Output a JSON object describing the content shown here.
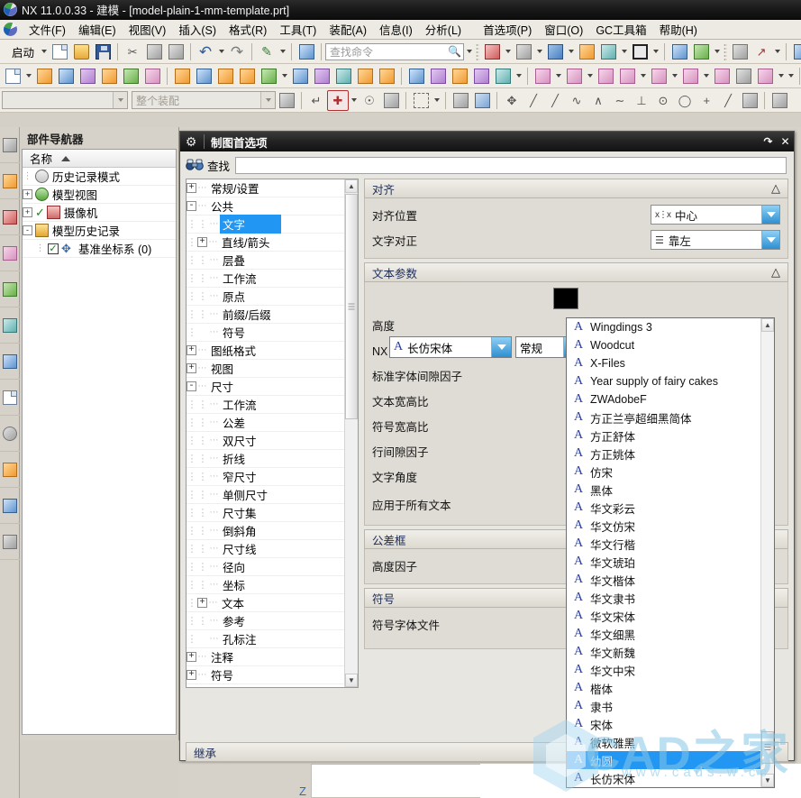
{
  "window": {
    "title": "NX 11.0.0.33 - 建模 - [model-plain-1-mm-template.prt]",
    "logo_icon": "nx-logo-icon"
  },
  "menubar": {
    "logo_icon": "nx-menu-logo-icon",
    "items": [
      {
        "label": "文件(F)",
        "name": "menu-file"
      },
      {
        "label": "编辑(E)",
        "name": "menu-edit"
      },
      {
        "label": "视图(V)",
        "name": "menu-view"
      },
      {
        "label": "插入(S)",
        "name": "menu-insert"
      },
      {
        "label": "格式(R)",
        "name": "menu-format"
      },
      {
        "label": "工具(T)",
        "name": "menu-tools"
      },
      {
        "label": "装配(A)",
        "name": "menu-assemblies"
      },
      {
        "label": "信息(I)",
        "name": "menu-information"
      },
      {
        "label": "分析(L)",
        "name": "menu-analysis"
      },
      {
        "label": "首选项(P)",
        "name": "menu-preferences"
      },
      {
        "label": "窗口(O)",
        "name": "menu-window"
      },
      {
        "label": "GC工具箱",
        "name": "menu-gc-toolbox"
      },
      {
        "label": "帮助(H)",
        "name": "menu-help"
      }
    ]
  },
  "toolbar_standard": {
    "start_label": "启动",
    "find_command_placeholder": "查找命令",
    "icons": [
      "new-document-icon",
      "open-folder-icon",
      "save-icon",
      "cut-icon",
      "copy-icon",
      "paste-icon",
      "undo-icon",
      "redo-icon",
      "paint-icon",
      "snapshot-icon"
    ]
  },
  "toolbar_view": {
    "icons": [
      "fit-window-icon",
      "zoom-icon",
      "rotate-cube-icon",
      "pan-icon",
      "style-icon",
      "shade-icon",
      "section-icon",
      "clip-icon",
      "layer-icon",
      "wcs-icon",
      "measure-icon",
      "color-icon"
    ]
  },
  "toolbar_feature": {
    "icons": [
      "sketch-icon",
      "datum-plane-icon",
      "extrude-icon",
      "revolve-icon",
      "hole-icon",
      "boss-icon",
      "pocket-icon",
      "pad-icon",
      "slot-icon",
      "groove-icon",
      "blend-icon",
      "chamfer-icon",
      "draft-icon",
      "trim-icon",
      "offset-icon",
      "pattern-icon",
      "mirror-icon",
      "thread-icon",
      "shell-icon",
      "unite-icon",
      "subtract-icon",
      "intersect-icon",
      "move-face-icon",
      "tube-icon"
    ]
  },
  "toolbar_selection": {
    "filter_value": "",
    "scope_value": "整个装配",
    "icons": [
      "select-object-icon",
      "snap-point-filter-icon",
      "add-snap-point-icon",
      "wcs-origin-icon",
      "curve-rule-icon",
      "rectangle-select-icon",
      "solid-body-icon",
      "shaded-cube-icon",
      "move-object-icon",
      "line-icon",
      "line2-icon",
      "spline-icon",
      "arc-through-icon",
      "studio-spline-icon",
      "perpendicular-icon",
      "circle-center-icon",
      "circle-icon",
      "plus-icon",
      "diagonal-icon",
      "sheet-icon",
      "grid-icon"
    ]
  },
  "part_navigator": {
    "title": "部件导航器",
    "column_header": "名称",
    "sort_icon": "sort-ascending-icon",
    "rows": [
      {
        "label": "历史记录模式",
        "icon": "clock-icon",
        "expander": null,
        "checkbox": false,
        "depth": 1
      },
      {
        "label": "模型视图",
        "icon": "model-views-icon",
        "expander": "+",
        "checkbox": false,
        "depth": 0
      },
      {
        "label": "摄像机",
        "icon": "camera-icon",
        "expander": "+",
        "checkbox": false,
        "depth": 0,
        "check_mark": true
      },
      {
        "label": "模型历史记录",
        "icon": "folder-open-icon",
        "expander": "-",
        "checkbox": false,
        "depth": 0
      },
      {
        "label": "基准坐标系 (0)",
        "icon": "datum-csys-icon",
        "expander": null,
        "checkbox": true,
        "depth": 1
      }
    ]
  },
  "rail": {
    "icons": [
      "assembly-navigator-icon",
      "constraint-navigator-icon",
      "part-navigator-icon",
      "reuse-library-icon",
      "cloud-library-icon",
      "help-web-icon",
      "hd3d-tools-icon",
      "history-icon",
      "roles-icon",
      "system-scene-icon",
      "system-visualization-icon"
    ]
  },
  "dialog": {
    "title": "制图首选项",
    "gear_icon": "gear-icon",
    "window_buttons": [
      "restore-icon",
      "close-icon"
    ],
    "find": {
      "icon": "binoculars-icon",
      "label": "查找",
      "value": "",
      "placeholder": ""
    },
    "tree": [
      {
        "label": "常规/设置",
        "expander": "+",
        "depth": 0,
        "selected": false
      },
      {
        "label": "公共",
        "expander": "-",
        "depth": 0,
        "selected": false
      },
      {
        "label": "文字",
        "expander": null,
        "depth": 2,
        "selected": true
      },
      {
        "label": "直线/箭头",
        "expander": "+",
        "depth": 1,
        "selected": false
      },
      {
        "label": "层叠",
        "expander": null,
        "depth": 2,
        "selected": false
      },
      {
        "label": "工作流",
        "expander": null,
        "depth": 2,
        "selected": false
      },
      {
        "label": "原点",
        "expander": null,
        "depth": 2,
        "selected": false
      },
      {
        "label": "前缀/后缀",
        "expander": null,
        "depth": 2,
        "selected": false
      },
      {
        "label": "符号",
        "expander": null,
        "depth": 2,
        "selected": false
      },
      {
        "label": "图纸格式",
        "expander": "+",
        "depth": 0,
        "selected": false
      },
      {
        "label": "视图",
        "expander": "+",
        "depth": 0,
        "selected": false
      },
      {
        "label": "尺寸",
        "expander": "-",
        "depth": 0,
        "selected": false
      },
      {
        "label": "工作流",
        "expander": null,
        "depth": 2,
        "selected": false
      },
      {
        "label": "公差",
        "expander": null,
        "depth": 2,
        "selected": false
      },
      {
        "label": "双尺寸",
        "expander": null,
        "depth": 2,
        "selected": false
      },
      {
        "label": "折线",
        "expander": null,
        "depth": 2,
        "selected": false
      },
      {
        "label": "窄尺寸",
        "expander": null,
        "depth": 2,
        "selected": false
      },
      {
        "label": "单侧尺寸",
        "expander": null,
        "depth": 2,
        "selected": false
      },
      {
        "label": "尺寸集",
        "expander": null,
        "depth": 2,
        "selected": false
      },
      {
        "label": "倒斜角",
        "expander": null,
        "depth": 2,
        "selected": false
      },
      {
        "label": "尺寸线",
        "expander": null,
        "depth": 2,
        "selected": false
      },
      {
        "label": "径向",
        "expander": null,
        "depth": 2,
        "selected": false
      },
      {
        "label": "坐标",
        "expander": null,
        "depth": 2,
        "selected": false
      },
      {
        "label": "文本",
        "expander": "+",
        "depth": 1,
        "selected": false
      },
      {
        "label": "参考",
        "expander": null,
        "depth": 2,
        "selected": false
      },
      {
        "label": "孔标注",
        "expander": null,
        "depth": 2,
        "selected": false
      },
      {
        "label": "注释",
        "expander": "+",
        "depth": 0,
        "selected": false
      },
      {
        "label": "符号",
        "expander": "+",
        "depth": 0,
        "selected": false
      }
    ],
    "sections": {
      "alignment": {
        "header": "对齐",
        "collapse_icon": "chevron-up-icon",
        "rows": [
          {
            "label": "对齐位置",
            "value": "中心",
            "value_icon": "align-center-icon"
          },
          {
            "label": "文字对正",
            "value": "靠左",
            "value_icon": "text-align-left-icon"
          }
        ]
      },
      "text_parameters": {
        "header": "文本参数",
        "collapse_icon": "chevron-up-icon",
        "color_swatch": "#000000",
        "font_name": "长仿宋体",
        "font_style": "常规",
        "rows": [
          {
            "label": "高度"
          },
          {
            "label": "NX 字体间隙因子"
          },
          {
            "label": "标准字体间隙因子"
          },
          {
            "label": "文本宽高比"
          },
          {
            "label": "符号宽高比"
          },
          {
            "label": "行间隙因子"
          },
          {
            "label": "文字角度"
          },
          {
            "label": "应用于所有文本"
          }
        ]
      },
      "tolerance_frame": {
        "header": "公差框",
        "rows": [
          {
            "label": "高度因子"
          }
        ]
      },
      "symbol": {
        "header": "符号",
        "rows": [
          {
            "label": "符号字体文件"
          }
        ]
      },
      "inherit": {
        "header": "继承"
      }
    },
    "font_dropdown": {
      "selected": "幼圆",
      "item_icon": "font-letter-a-icon",
      "items": [
        "Wingdings 3",
        "Woodcut",
        "X-Files",
        "Year supply of fairy cakes",
        "ZWAdobeF",
        "方正兰亭超细黑简体",
        "方正舒体",
        "方正姚体",
        "仿宋",
        "黑体",
        "华文彩云",
        "华文仿宋",
        "华文行楷",
        "华文琥珀",
        "华文楷体",
        "华文隶书",
        "华文宋体",
        "华文细黑",
        "华文新魏",
        "华文中宋",
        "楷体",
        "隶书",
        "宋体",
        "微软雅黑",
        "幼圆",
        "长仿宋体"
      ]
    }
  },
  "graphics": {
    "axis_label": "Z"
  },
  "watermark": {
    "big_text": "CAD之家",
    "small_text": "www.cads.w.cc"
  },
  "colors": {
    "accent": "#2196f3",
    "dialog_bg": "#e8e6e0",
    "titlebar": "#121212",
    "section_header_text": "#1d2c55"
  }
}
